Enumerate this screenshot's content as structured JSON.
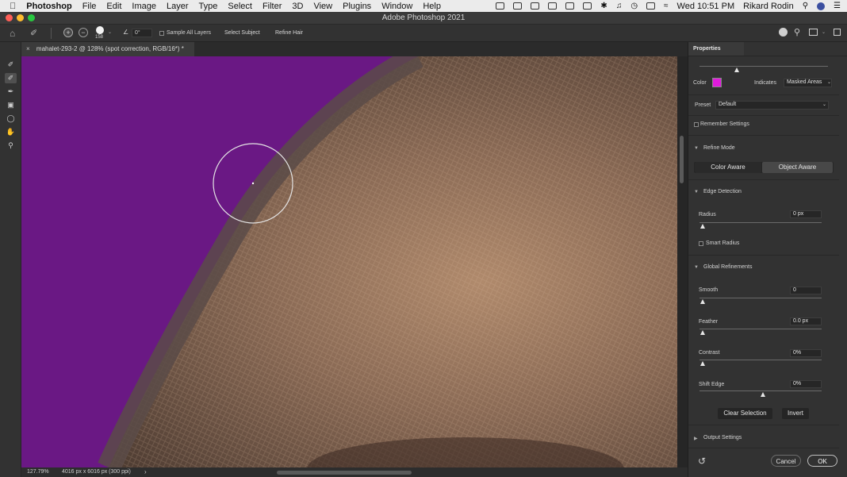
{
  "menubar": {
    "app": "Photoshop",
    "items": [
      "File",
      "Edit",
      "Image",
      "Layer",
      "Type",
      "Select",
      "Filter",
      "3D",
      "View",
      "Plugins",
      "Window",
      "Help"
    ],
    "clock": "Wed 10:51 PM",
    "user": "Rikard Rodin"
  },
  "window": {
    "title": "Adobe Photoshop 2021"
  },
  "options": {
    "brush_size": "158",
    "angle": "0°",
    "sample_all_layers": "Sample All Layers",
    "select_subject": "Select Subject",
    "refine_hair": "Refine Hair"
  },
  "document": {
    "tab_title": "mahalet-293-2 @ 128% (spot correction, RGB/16*) *",
    "zoom": "127.79%",
    "info": "4016 px x 6016 px (300 ppi)"
  },
  "panel": {
    "title": "Properties",
    "color_label": "Color",
    "overlay_color": "#e01bdc",
    "indicates_label": "Indicates",
    "indicates_value": "Masked Areas",
    "preset_label": "Preset",
    "preset_value": "Default",
    "remember_settings": "Remember Settings",
    "refine_mode": {
      "title": "Refine Mode",
      "color_aware": "Color Aware",
      "object_aware": "Object Aware"
    },
    "edge_detection": {
      "title": "Edge Detection",
      "radius_label": "Radius",
      "radius_value": "0 px",
      "smart_radius": "Smart Radius"
    },
    "global_refinements": {
      "title": "Global Refinements",
      "smooth_label": "Smooth",
      "smooth_value": "0",
      "feather_label": "Feather",
      "feather_value": "0.0 px",
      "contrast_label": "Contrast",
      "contrast_value": "0%",
      "shift_edge_label": "Shift Edge",
      "shift_edge_value": "0%"
    },
    "clear_selection": "Clear Selection",
    "invert": "Invert",
    "output_settings": "Output Settings",
    "cancel": "Cancel",
    "ok": "OK"
  }
}
